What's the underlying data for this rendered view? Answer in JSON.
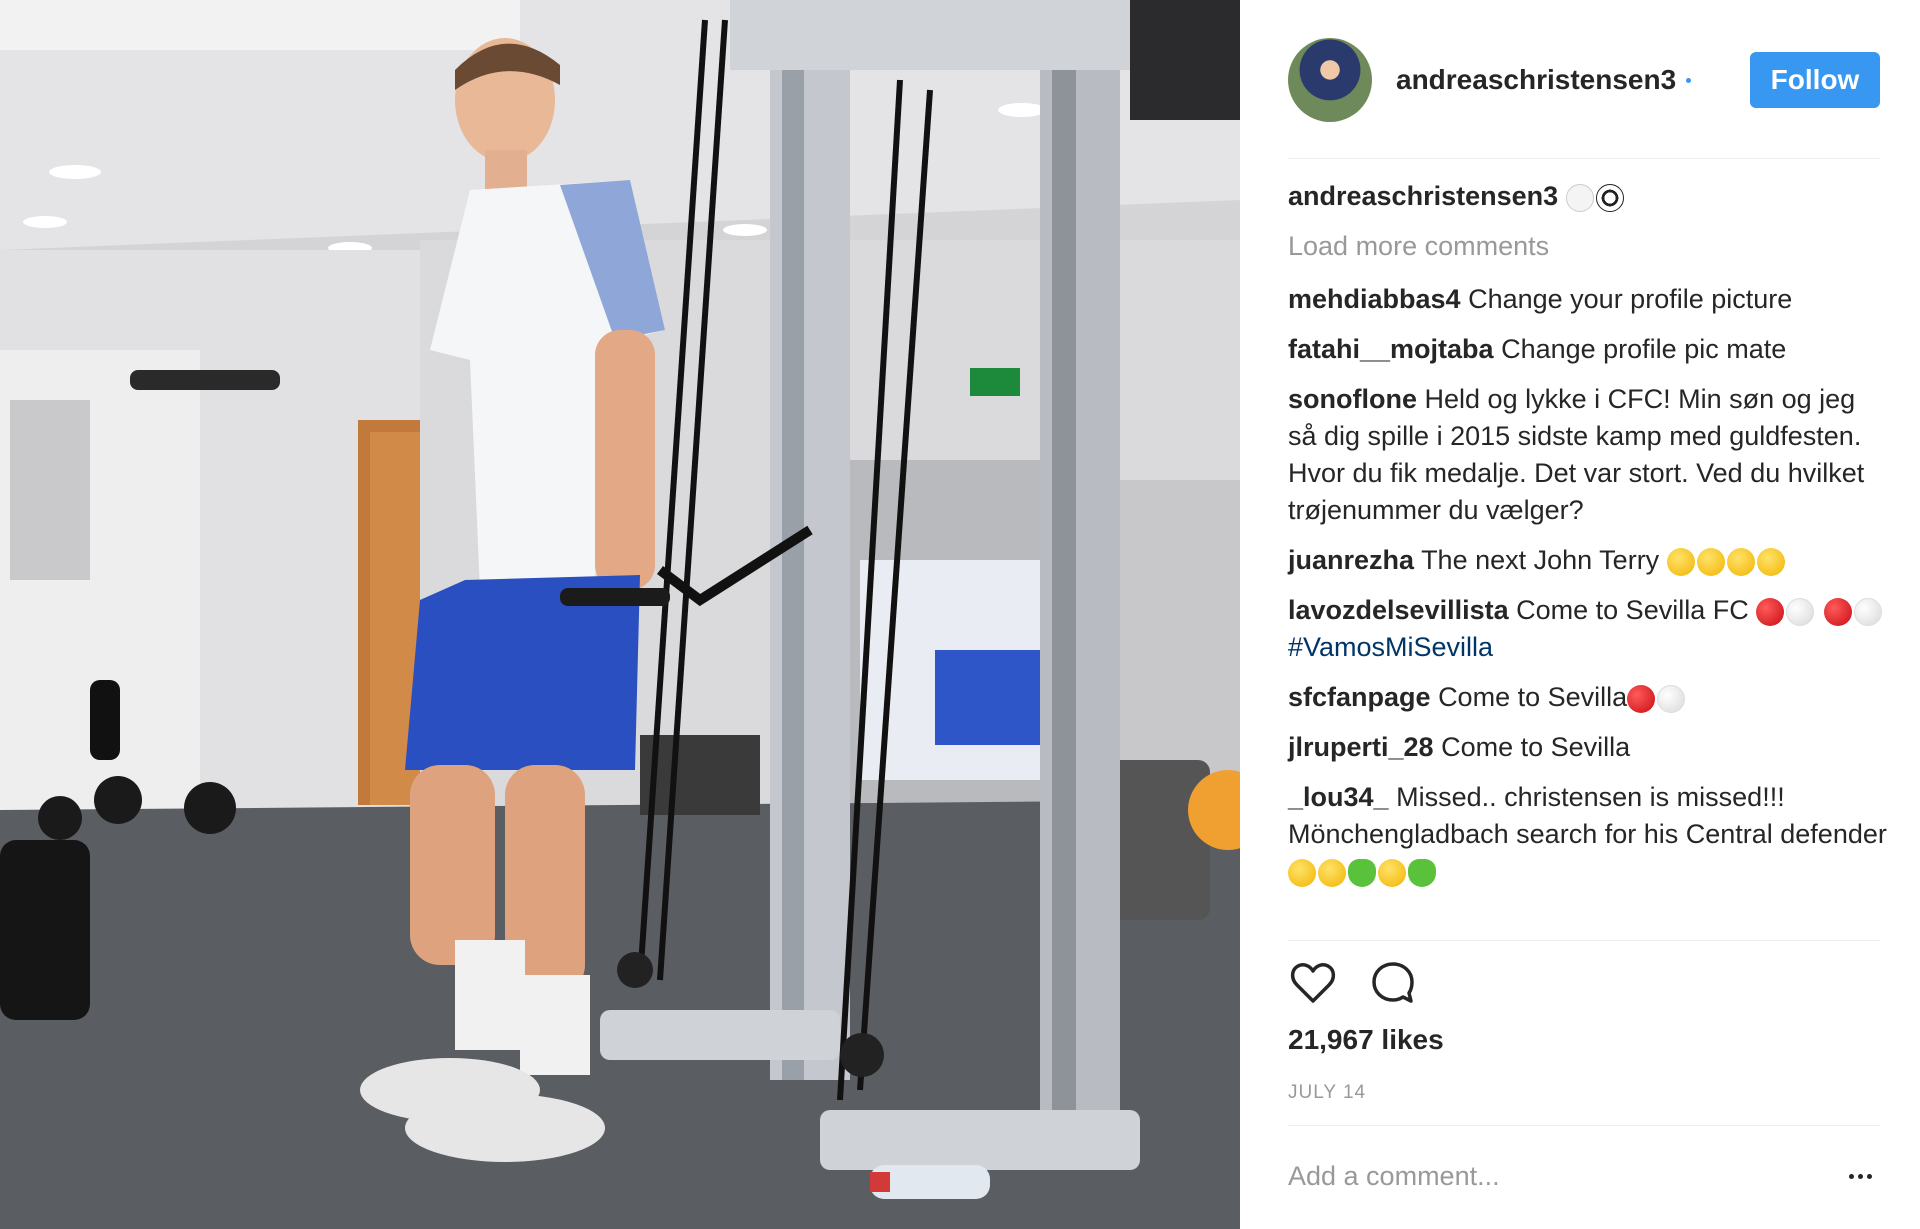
{
  "post": {
    "username": "andreaschristensen3",
    "follow_label": "Follow",
    "caption_emoji": "⚽"
  },
  "comments": {
    "load_more": "Load more comments",
    "items": [
      {
        "user": "mehdiabbas4",
        "text": "Change your profile picture"
      },
      {
        "user": "fatahi__mojtaba",
        "text": "Change profile pic mate"
      },
      {
        "user": "sonoflone",
        "text": "Held og lykke i CFC! Min søn og jeg så dig spille i 2015 sidste kamp med guldfesten. Hvor du fik medalje. Det var stort. Ved du hvilket trøjenummer du vælger?"
      },
      {
        "user": "juanrezha",
        "text": "The next John Terry"
      },
      {
        "user": "lavozdelsevillista",
        "text": "Come to Sevilla FC",
        "hashtag": "#VamosMiSevilla"
      },
      {
        "user": "sfcfanpage",
        "text": "Come to Sevilla"
      },
      {
        "user": "jlruperti_28",
        "text": "Come to Sevilla"
      },
      {
        "user": "_lou34_",
        "text": "Missed.. christensen is missed!!! Mönchengladbach search for his Central defender"
      }
    ]
  },
  "stats": {
    "likes": "21,967 likes",
    "date": "JULY 14"
  },
  "add_comment": {
    "placeholder": "Add a comment..."
  },
  "icons": {
    "like": "heart-icon",
    "comment": "comment-bubble-icon",
    "options": "more-options-icon"
  },
  "colors": {
    "follow_bg": "#3897f0",
    "hashtag": "#003569",
    "muted": "#999999"
  }
}
